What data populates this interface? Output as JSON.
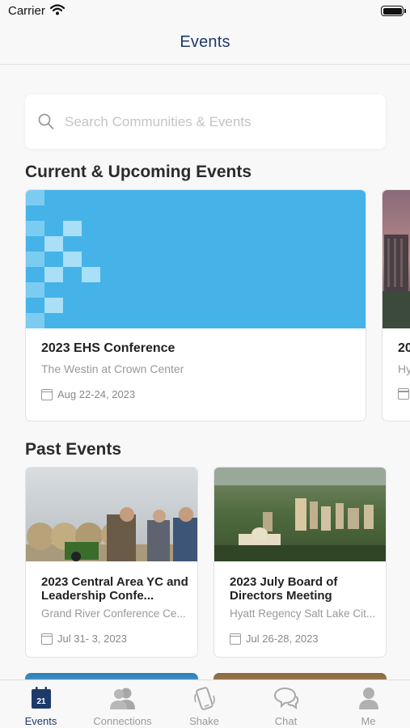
{
  "status_bar": {
    "carrier": "Carrier"
  },
  "nav": {
    "title": "Events"
  },
  "search": {
    "placeholder": "Search Communities & Events"
  },
  "sections": {
    "current": "Current & Upcoming Events",
    "past": "Past Events"
  },
  "current_events": [
    {
      "title": "2023 EHS Conference",
      "venue": "The Westin at Crown Center",
      "date": "Aug 22-24, 2023"
    },
    {
      "title": "20",
      "venue": "Hy",
      "date": ""
    }
  ],
  "past_events": [
    {
      "title": "2023 Central Area YC and Leadership Confe...",
      "venue": "Grand River Conference Ce...",
      "date": "Jul 31- 3, 2023"
    },
    {
      "title": "2023 July Board of Directors Meeting",
      "venue": "Hyatt Regency Salt Lake Cit...",
      "date": "Jul 26-28, 2023"
    }
  ],
  "tabs": [
    {
      "label": "Events",
      "icon": "calendar-icon",
      "active": true
    },
    {
      "label": "Connections",
      "icon": "people-icon",
      "active": false
    },
    {
      "label": "Shake",
      "icon": "shake-phone-icon",
      "active": false
    },
    {
      "label": "Chat",
      "icon": "chat-bubbles-icon",
      "active": false
    },
    {
      "label": "Me",
      "icon": "person-icon",
      "active": false
    }
  ],
  "calendar_icon_day": "21",
  "colors": {
    "brand": "#1e3a6b",
    "banner_blue": "#45b3e7",
    "inactive": "#9a9a9a"
  }
}
